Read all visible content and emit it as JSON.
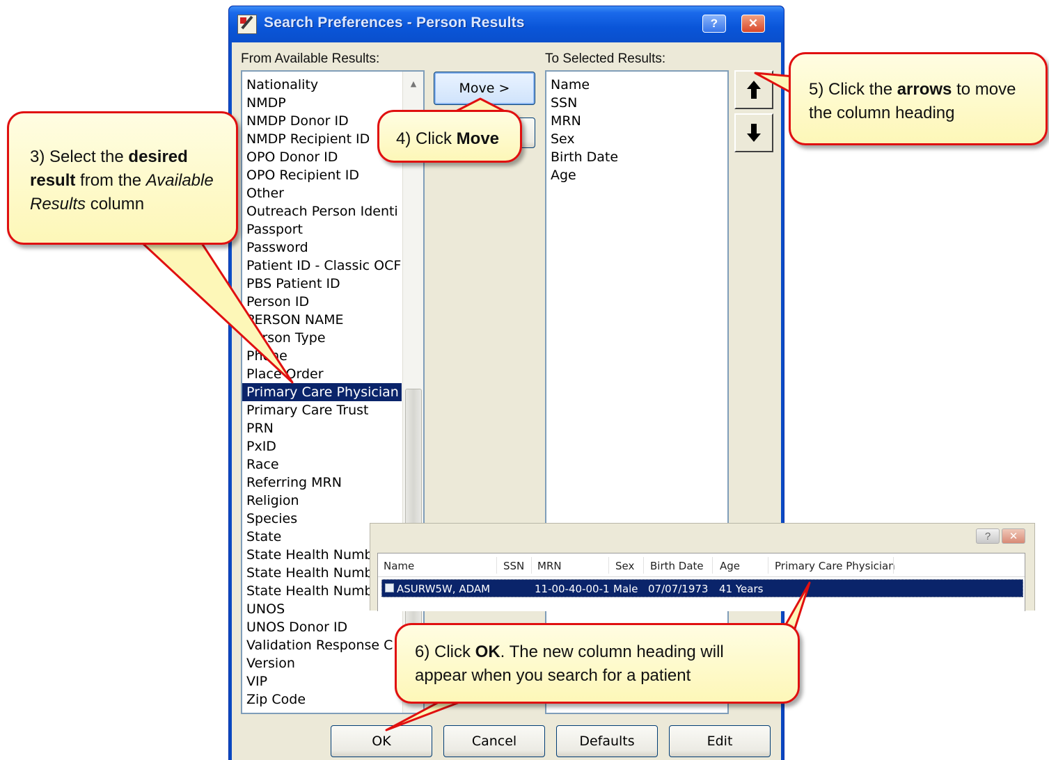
{
  "dialog": {
    "title": "Search Preferences - Person Results",
    "help_label": "?",
    "close_label": "✕",
    "available_label": "From Available Results:",
    "selected_label": "To Selected Results:",
    "available_items": [
      "Nationality",
      "NMDP",
      "NMDP Donor ID",
      "NMDP Recipient ID",
      "OPO Donor ID",
      "OPO Recipient ID",
      "Other",
      "Outreach Person Identi",
      "Passport",
      "Password",
      "Patient ID - Classic OCF",
      "PBS Patient ID",
      "Person ID",
      "PERSON NAME",
      "Person Type",
      "Phone",
      "Place Order",
      "Primary Care Physician",
      "Primary Care Trust",
      "PRN",
      "PxID",
      "Race",
      "Referring MRN",
      "Religion",
      "Species",
      "State",
      "State Health Numb",
      "State Health Numb",
      "State Health Numb",
      "UNOS",
      "UNOS Donor ID",
      "Validation Response C",
      "Version",
      "VIP",
      "Zip Code"
    ],
    "selected_available_item": "Primary Care Physician",
    "selected_items": [
      "Name",
      "SSN",
      "MRN",
      "Sex",
      "Birth Date",
      "Age"
    ],
    "move_button": "Move >",
    "ok_button": "OK",
    "cancel_button": "Cancel",
    "defaults_button": "Defaults",
    "edit_button": "Edit"
  },
  "results_grid": {
    "help_label": "?",
    "close_label": "✕",
    "columns": [
      "Name",
      "SSN",
      "MRN",
      "Sex",
      "Birth Date",
      "Age",
      "Primary Care Physician"
    ],
    "row": {
      "name": "ASURW5W, ADAM",
      "ssn": "",
      "mrn": "11-00-40-00-1",
      "sex": "Male",
      "birth_date": "07/07/1973",
      "age": "41 Years",
      "pcp": ""
    }
  },
  "callouts": {
    "step3": {
      "pre": "3) Select the ",
      "b1": "desired result",
      "mid": " from the ",
      "i1": "Available Results",
      "post": " column"
    },
    "step4": {
      "pre": "4) Click ",
      "b1": "Move"
    },
    "step5": {
      "pre": "5) Click the ",
      "b1": "arrows",
      "post": " to move the column heading"
    },
    "step6": {
      "pre": "6) Click ",
      "b1": "OK",
      "post": ".  The new column heading will appear when you search for a patient"
    }
  },
  "colors": {
    "callout_border": "#e01010",
    "callout_fill": "#fdf7b8",
    "selection": "#0a246a",
    "titlebar": "#0a55d8"
  }
}
